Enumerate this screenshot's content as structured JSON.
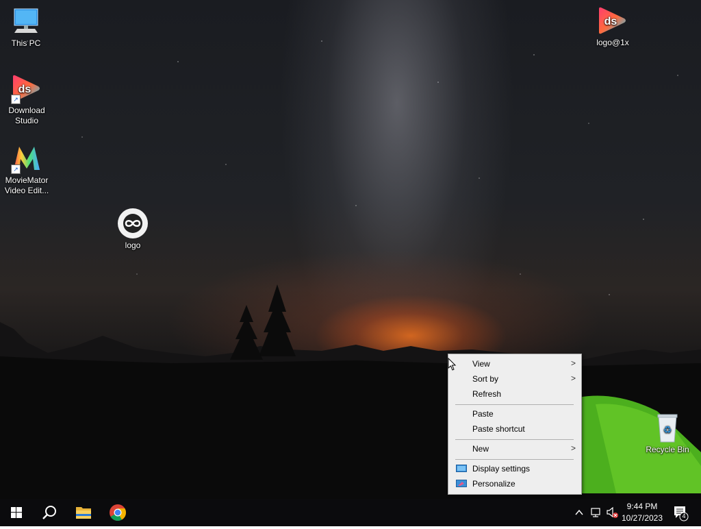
{
  "desktop_icons": {
    "this_pc": "This PC",
    "download_studio_line1": "Download",
    "download_studio_line2": "Studio",
    "moviemator_line1": "MovieMator",
    "moviemator_line2": "Video Edit...",
    "logo": "logo",
    "logo1x": "logo@1x",
    "recycle_bin": "Recycle Bin",
    "ds_logo_text": "ds"
  },
  "context_menu": {
    "view": "View",
    "sort_by": "Sort by",
    "refresh": "Refresh",
    "paste": "Paste",
    "paste_shortcut": "Paste shortcut",
    "new": "New",
    "display_settings": "Display settings",
    "personalize": "Personalize",
    "submenu_arrow": ">"
  },
  "taskbar": {
    "time": "9:44 PM",
    "date": "10/27/2023",
    "notification_count": "4",
    "icons": [
      "windows-start-icon",
      "search-icon",
      "file-explorer-icon",
      "chrome-icon"
    ],
    "tray_icons": [
      "chevron-up-icon",
      "network-icon",
      "volume-muted-icon",
      "notification-icon"
    ]
  },
  "colors": {
    "taskbar": "#0b0b0d",
    "menu_bg": "#eeeeee",
    "ds_gradient_start": "#ff3d6e",
    "ds_gradient_end": "#2ec5e8"
  }
}
